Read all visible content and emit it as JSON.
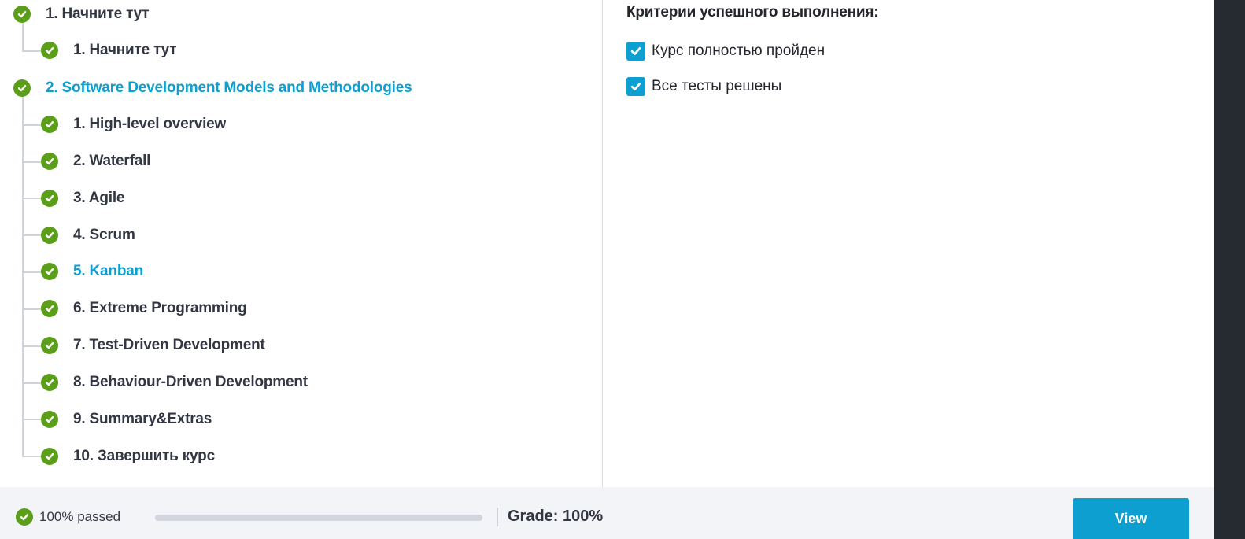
{
  "course_tree": {
    "sections": [
      {
        "label": "1. Начните тут",
        "status": "passed",
        "lessons": [
          {
            "label": "1. Начните тут",
            "status": "passed"
          }
        ]
      },
      {
        "label": "2. Software Development Models and Methodologies",
        "status": "passed",
        "active": true,
        "lessons": [
          {
            "label": "1. High-level overview",
            "status": "passed"
          },
          {
            "label": "2. Waterfall",
            "status": "passed"
          },
          {
            "label": "3. Agile",
            "status": "passed"
          },
          {
            "label": "4. Scrum",
            "status": "passed"
          },
          {
            "label": "5. Kanban",
            "status": "passed",
            "active": true
          },
          {
            "label": "6. Extreme Programming",
            "status": "passed"
          },
          {
            "label": "7. Test-Driven Development",
            "status": "passed"
          },
          {
            "label": "8. Behaviour-Driven Development",
            "status": "passed"
          },
          {
            "label": "9. Summary&Extras",
            "status": "passed"
          },
          {
            "label": "10. Завершить курс",
            "status": "passed"
          }
        ]
      }
    ]
  },
  "criteria": {
    "title": "Критерии успешного выполнения:",
    "items": [
      {
        "label": "Курс полностью пройден",
        "checked": true
      },
      {
        "label": "Все тесты решены",
        "checked": true
      }
    ]
  },
  "footer": {
    "passed_label": "100% passed",
    "progress_percent": 100,
    "grade_label": "Grade: 100%",
    "view_button": "View"
  },
  "colors": {
    "accent": "#0c9fcf",
    "success": "#5a9e1a",
    "text": "#333743",
    "footer_bg": "#f3f4f8"
  },
  "icons": {
    "status": "check-circle-icon",
    "criterion": "checkbox-checked-icon"
  }
}
